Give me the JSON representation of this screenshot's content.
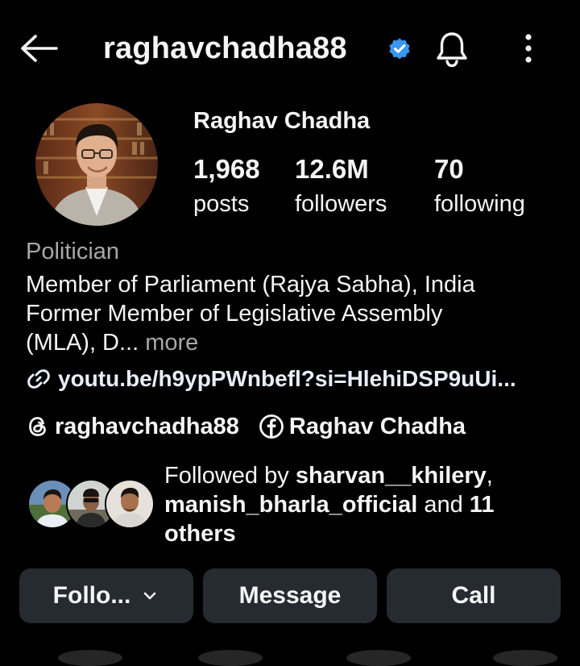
{
  "header": {
    "username": "raghavchadha88",
    "icons": {
      "back": "arrow-left-icon",
      "verified": "verified-badge-icon",
      "bell": "bell-icon",
      "more": "more-vertical-icon"
    }
  },
  "profile": {
    "display_name": "Raghav Chadha",
    "stats": [
      {
        "value": "1,968",
        "label": "posts"
      },
      {
        "value": "12.6M",
        "label": "followers"
      },
      {
        "value": "70",
        "label": "following"
      }
    ],
    "category": "Politician",
    "bio_line1": "Member of Parliament (Rajya Sabha), India",
    "bio_line2": "Former Member of Legislative Assembly",
    "bio_line3": "(MLA), D...",
    "bio_more": "more",
    "link": "youtu.be/h9ypPWnbefl?si=HlehiDSP9uUi...",
    "threads_handle": "raghavchadha88",
    "facebook_name": "Raghav Chadha"
  },
  "followed_by": {
    "prefix": "Followed by",
    "user1": "sharvan__khilery",
    "comma": ",",
    "user2": "manish_bharla_official",
    "joiner": "and",
    "count": "11",
    "suffix": "others"
  },
  "actions": {
    "follow": "Follo...",
    "message": "Message",
    "call": "Call"
  },
  "colors": {
    "background": "#000000",
    "button": "#262a31",
    "verified": "#3897f0",
    "muted_text": "#a8a8a8"
  }
}
